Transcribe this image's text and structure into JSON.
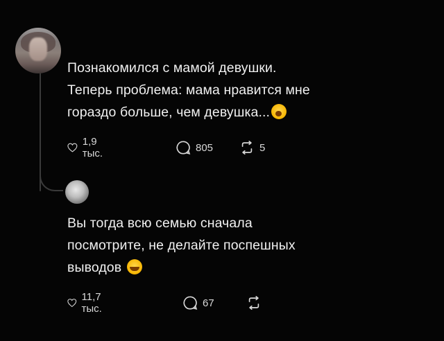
{
  "post": {
    "text_line1": "Познакомился с мамой девушки.",
    "text_line2": "Теперь проблема: мама нравится мне",
    "text_line3": "гораздо больше, чем девушка...",
    "emoji": "astonished-face",
    "likes": "1,9 тыс.",
    "comments": "805",
    "reposts": "5"
  },
  "reply": {
    "text_line1": "Вы тогда всю семью сначала",
    "text_line2": "посмотрите, не делайте поспешных",
    "text_line3": "выводов",
    "emoji": "tears-of-joy-face",
    "likes": "11,7 тыс.",
    "comments": "67"
  }
}
